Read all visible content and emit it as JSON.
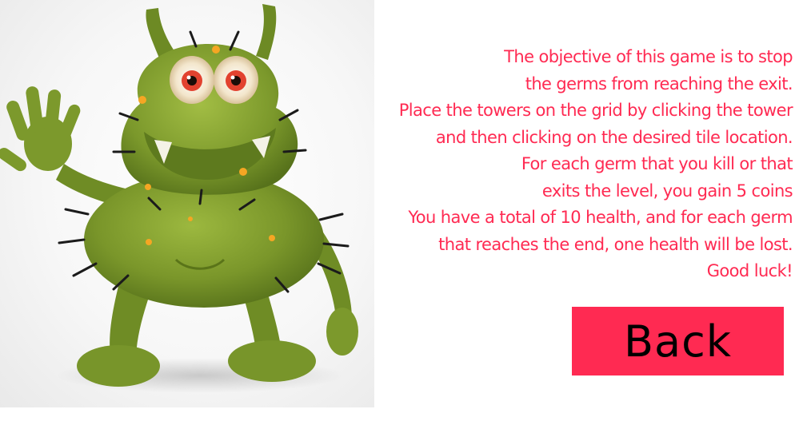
{
  "colors": {
    "accent": "#ff2a52",
    "text": "#ff2a52",
    "button_text": "#000000",
    "background": "#ffffff",
    "germ_green": "#7d9a2b"
  },
  "character": {
    "icon": "germ-monster-illustration"
  },
  "instructions": {
    "lines": [
      "The objective of this game is to stop",
      "the germs from reaching the exit.",
      "Place the towers on the grid by clicking the tower",
      "and then clicking on the desired tile location.",
      "For each germ that you kill or that",
      "exits the level, you gain 5 coins",
      "You have a total of 10 health, and for each germ",
      "that reaches the end, one health will be lost.",
      "Good luck!"
    ]
  },
  "back_button": {
    "label": "Back"
  }
}
